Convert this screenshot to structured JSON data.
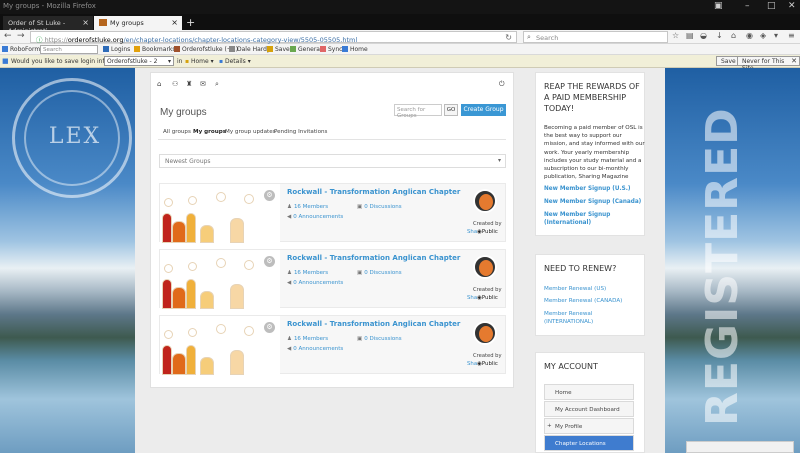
{
  "browser": {
    "window_title": "My groups - Mozilla Firefox",
    "tabs": [
      {
        "label": "Order of St Luke - Administrati..."
      },
      {
        "label": "My groups"
      }
    ],
    "url_prefix": "https://",
    "url_host": "orderofstluke.org",
    "url_path": "/en/chapter-locations/chapter-locations-category-view/5505-05505.html",
    "search_placeholder": "Search",
    "bookmarks": [
      {
        "label": "RoboForm",
        "icon": "roboform-icon",
        "color": "#3a7bd5"
      },
      {
        "label": "Logins",
        "icon": "logins-icon",
        "color": "#2d6bb8"
      },
      {
        "label": "Bookmarks",
        "icon": "bookmarks-icon",
        "color": "#e2a10c"
      },
      {
        "label": "Orderofstluke (+2)",
        "icon": "site-icon",
        "color": "#a0522d"
      },
      {
        "label": "Dale Hardy",
        "icon": "user-icon",
        "color": "#888888"
      },
      {
        "label": "Save",
        "icon": "save-icon",
        "color": "#d6a20d"
      },
      {
        "label": "Generate",
        "icon": "generate-icon",
        "color": "#6aa84f"
      },
      {
        "label": "Sync",
        "icon": "sync-icon",
        "color": "#e06666"
      },
      {
        "label": "Home",
        "icon": "home-icon",
        "color": "#3a7bd5"
      }
    ],
    "bookmark_search_placeholder": "Search",
    "save_prompt": {
      "question": "Would you like to save login info as:",
      "identity": "Orderofstluke - 2",
      "in_label": "in",
      "home_label": "Home",
      "details_label": "Details",
      "save_button": "Save",
      "never_button": "Never for This Site"
    }
  },
  "page": {
    "title": "My groups",
    "search_placeholder": "Search for Groups",
    "go_label": "GO",
    "create_label": "Create Group",
    "tabs": [
      "All groups",
      "My groups",
      "My group updates",
      "Pending Invitations"
    ],
    "sort_label": "Newest Groups",
    "groups": [
      {
        "name": "Rockwall - Transformation Anglican Chapter",
        "members": "16 Members",
        "discussions": "0 Discussions",
        "announcements": "0 Announcements",
        "created_by": "Created by",
        "privacy_prefix": "Sha",
        "privacy": "Public"
      },
      {
        "name": "Rockwall - Transformation Anglican Chapter",
        "members": "16 Members",
        "discussions": "0 Discussions",
        "announcements": "0 Announcements",
        "created_by": "Created by",
        "privacy_prefix": "Sha",
        "privacy": "Public"
      },
      {
        "name": "Rockwall - Transformation Anglican Chapter",
        "members": "16 Members",
        "discussions": "0 Discussions",
        "announcements": "0 Announcements",
        "created_by": "Created by",
        "privacy_prefix": "Sha",
        "privacy": "Public"
      }
    ]
  },
  "sidebar": {
    "rewards": {
      "title": "REAP THE REWARDS OF A PAID MEMBERSHIP TODAY!",
      "body": "Becoming a paid member of OSL is the best way to support our mission, and stay informed with our work. Your yearly membership includes your study material and a subscription to our bi-monthly publication, Sharing Magazine",
      "links": [
        "New Member Signup (U.S.)",
        "New Member Signup (Canada)",
        "New Member Signup (International)"
      ]
    },
    "renew": {
      "title": "NEED TO RENEW?",
      "links": [
        "Member Renewal (US)",
        "Member Renewal (CANADA)",
        "Member Renewal (INTERNATIONAL)"
      ]
    },
    "account": {
      "title": "MY ACCOUNT",
      "items": [
        "Home",
        "My Account Dashboard",
        "My Profile",
        "Chapter Locations"
      ]
    }
  },
  "background": {
    "left_seal_text": "LEX",
    "right_watermark": "REGISTERED"
  },
  "colors": {
    "accent": "#3a97d4",
    "link": "#3a93cf",
    "active_nav": "#3f7ccf"
  }
}
